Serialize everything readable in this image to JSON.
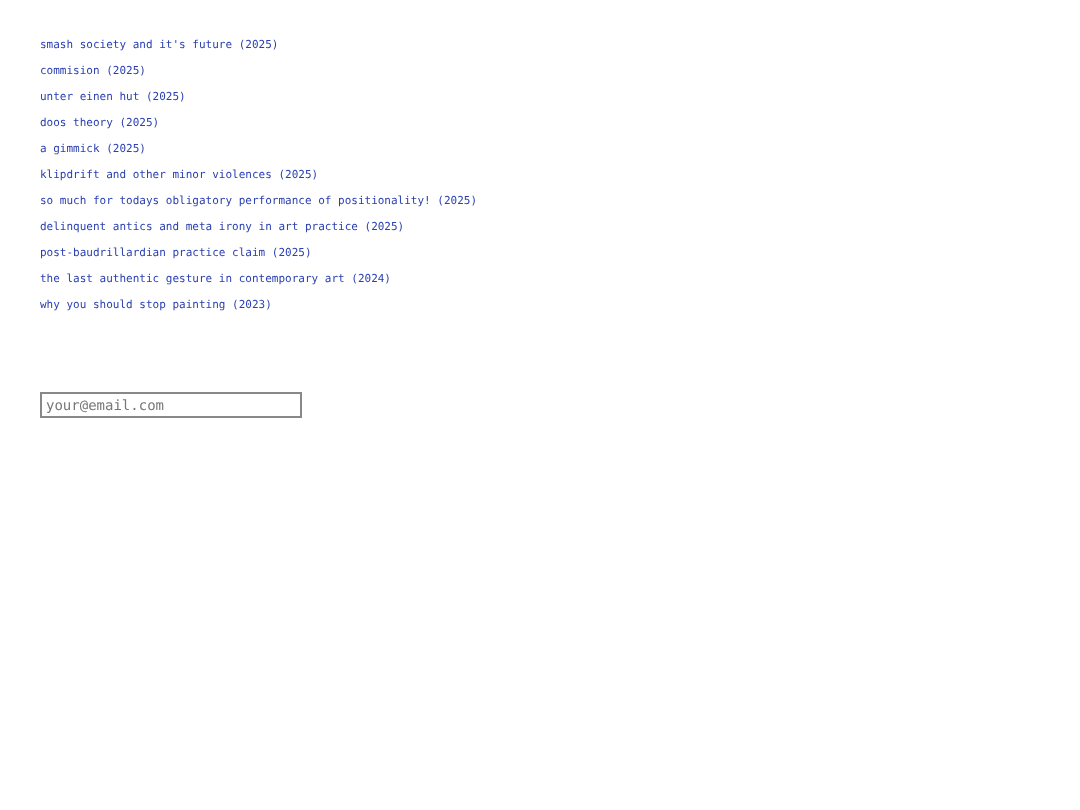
{
  "posts": [
    {
      "title": "smash society and it's future (2025)"
    },
    {
      "title": "commision (2025)"
    },
    {
      "title": "unter einen hut (2025)"
    },
    {
      "title": "doos theory (2025)"
    },
    {
      "title": "a gimmick (2025)"
    },
    {
      "title": "klipdrift and other minor violences (2025)"
    },
    {
      "title": "so much for todays obligatory performance of positionality! (2025)"
    },
    {
      "title": "delinquent antics and meta irony in art practice (2025)"
    },
    {
      "title": "post-baudrillardian practice claim (2025)"
    },
    {
      "title": "the last authentic gesture in contemporary art (2024)"
    },
    {
      "title": "why you should stop painting (2023)"
    }
  ],
  "subscribe": {
    "placeholder": "your@email.com"
  }
}
